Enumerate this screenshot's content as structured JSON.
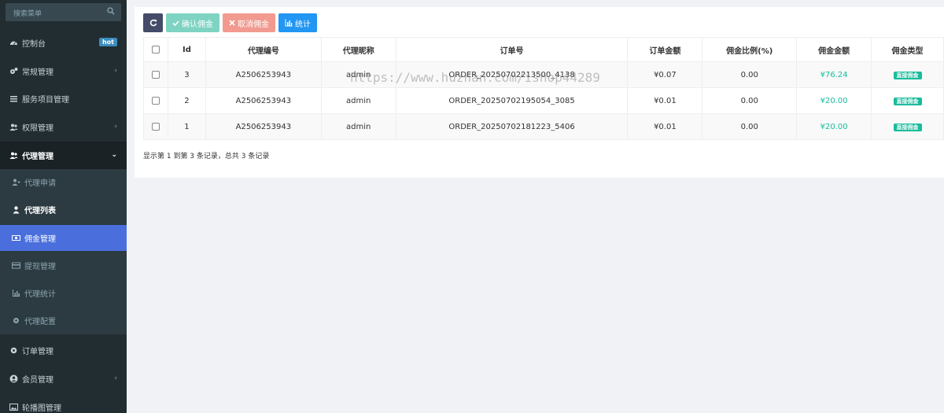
{
  "sidebar": {
    "search_placeholder": "搜索菜单",
    "menu": {
      "dashboard": {
        "label": "控制台",
        "badge": "hot",
        "icon": "dashboard-icon"
      },
      "general": {
        "label": "常规管理",
        "icon": "gears-icon"
      },
      "service": {
        "label": "服务项目管理",
        "icon": "list-icon"
      },
      "permission": {
        "label": "权限管理",
        "icon": "users-icon"
      },
      "agent": {
        "label": "代理管理",
        "icon": "users-icon"
      },
      "order": {
        "label": "订单管理",
        "icon": "gear-icon"
      },
      "member": {
        "label": "会员管理",
        "icon": "user-circle-icon"
      },
      "carousel": {
        "label": "轮播图管理",
        "icon": "image-icon"
      }
    },
    "agent_submenu": [
      {
        "label": "代理申请",
        "icon": "user-plus-icon"
      },
      {
        "label": "代理列表",
        "icon": "user-icon"
      },
      {
        "label": "佣金管理",
        "icon": "money-icon"
      },
      {
        "label": "提现管理",
        "icon": "credit-card-icon"
      },
      {
        "label": "代理统计",
        "icon": "bar-chart-icon"
      },
      {
        "label": "代理配置",
        "icon": "gear-icon"
      }
    ]
  },
  "toolbar": {
    "confirm_label": "确认佣金",
    "cancel_label": "取消佣金",
    "stats_label": "统计"
  },
  "table": {
    "headers": [
      "Id",
      "代理编号",
      "代理昵称",
      "订单号",
      "订单金额",
      "佣金比例(%)",
      "佣金金额",
      "佣金类型"
    ],
    "rows": [
      {
        "id": "3",
        "agent_no": "A2506253943",
        "nickname": "admin",
        "order_no": "ORDER_20250702213500_4138",
        "order_amount": "¥0.07",
        "rate": "0.00",
        "commission": "¥76.24",
        "type": "直接佣金"
      },
      {
        "id": "2",
        "agent_no": "A2506253943",
        "nickname": "admin",
        "order_no": "ORDER_20250702195054_3085",
        "order_amount": "¥0.01",
        "rate": "0.00",
        "commission": "¥20.00",
        "type": "直接佣金"
      },
      {
        "id": "1",
        "agent_no": "A2506253943",
        "nickname": "admin",
        "order_no": "ORDER_20250702181223_5406",
        "order_amount": "¥0.01",
        "rate": "0.00",
        "commission": "¥20.00",
        "type": "直接佣金"
      }
    ]
  },
  "pager": {
    "info": "显示第 1 到第 3 条记录，总共 3 条记录"
  },
  "watermark": "https://www.huzhan.com/ishop44289",
  "colors": {
    "sidebar_bg": "#222d32",
    "active_item": "#4a6fdc",
    "green": "#18bc9c"
  }
}
